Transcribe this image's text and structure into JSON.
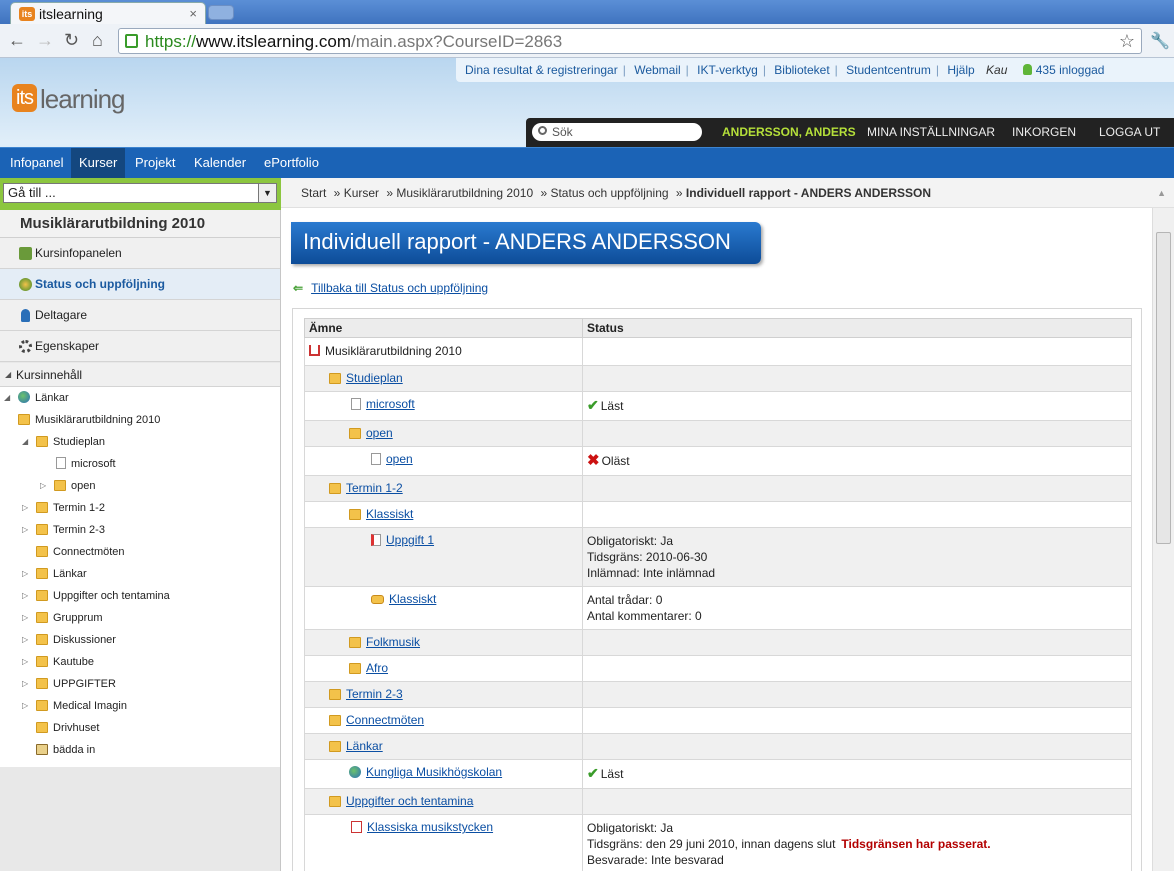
{
  "browser": {
    "tab_title": "itslearning",
    "tab_favicon": "its",
    "url_scheme": "https://",
    "url_host": "www.itslearning.com",
    "url_path": "/main.aspx?CourseID=2863"
  },
  "header": {
    "logo_badge": "its",
    "logo_text": "learning",
    "top_links": [
      "Dina resultat & registreringar",
      "Webmail",
      "IKT-verktyg",
      "Biblioteket",
      "Studentcentrum",
      "Hjälp"
    ],
    "user_short": "Kau",
    "online_count": "435 inloggad",
    "search_placeholder": "Sök",
    "user_name": "ANDERSSON, ANDERS",
    "settings": "MINA INSTÄLLNINGAR",
    "inbox": "INKORGEN",
    "logout": "LOGGA UT",
    "menu": [
      "Infopanel",
      "Kurser",
      "Projekt",
      "Kalender",
      "ePortfolio"
    ]
  },
  "sidebar": {
    "goto": "Gå till ...",
    "course_name": "Musiklärarutbildning 2010",
    "items": [
      "Kursinfopanelen",
      "Status och uppföljning",
      "Deltagare",
      "Egenskaper"
    ],
    "content_heading": "Kursinnehåll",
    "tree": [
      "Länkar",
      "Musiklärarutbildning 2010",
      "Studieplan",
      "microsoft",
      "open",
      "Termin 1-2",
      "Termin 2-3",
      "Connectmöten",
      "Länkar",
      "Uppgifter och tentamina",
      "Grupprum",
      "Diskussioner",
      "Kautube",
      "UPPGIFTER",
      "Medical Imagin",
      "Drivhuset",
      "bädda in"
    ]
  },
  "breadcrumb": [
    "Start",
    "Kurser",
    "Musiklärarutbildning 2010",
    "Status och uppföljning",
    "Individuell rapport - ANDERS ANDERSSON"
  ],
  "page": {
    "title": "Individuell rapport - ANDERS ANDERSSON",
    "back_link": "Tillbaka till Status och uppföljning",
    "col_subject": "Ämne",
    "col_status": "Status"
  },
  "rows": [
    {
      "name": "Musiklärarutbildning 2010",
      "status": ""
    },
    {
      "name": "Studieplan",
      "status": ""
    },
    {
      "name": "microsoft",
      "status": "Läst"
    },
    {
      "name": "open",
      "status": ""
    },
    {
      "name": "open",
      "status": "Oläst"
    },
    {
      "name": "Termin 1-2",
      "status": ""
    },
    {
      "name": "Klassiskt",
      "status": ""
    },
    {
      "name": "Uppgift 1",
      "s1": "Obligatoriskt: Ja",
      "s2": "Tidsgräns: 2010-06-30",
      "s3": "Inlämnad: Inte inlämnad"
    },
    {
      "name": "Klassiskt",
      "s1": "Antal trådar: 0",
      "s2": "Antal kommentarer: 0"
    },
    {
      "name": "Folkmusik",
      "status": ""
    },
    {
      "name": "Afro",
      "status": ""
    },
    {
      "name": "Termin 2-3",
      "status": ""
    },
    {
      "name": "Connectmöten",
      "status": ""
    },
    {
      "name": "Länkar",
      "status": ""
    },
    {
      "name": "Kungliga Musikhögskolan",
      "status": "Läst"
    },
    {
      "name": "Uppgifter och tentamina",
      "status": ""
    },
    {
      "name": "Klassiska musikstycken",
      "s1": "Obligatoriskt: Ja",
      "s2": "Tidsgräns: den 29 juni 2010, innan dagens slut",
      "s2warn": "Tidsgränsen har passerat.",
      "s3": "Besvarade: Inte besvarad"
    }
  ]
}
